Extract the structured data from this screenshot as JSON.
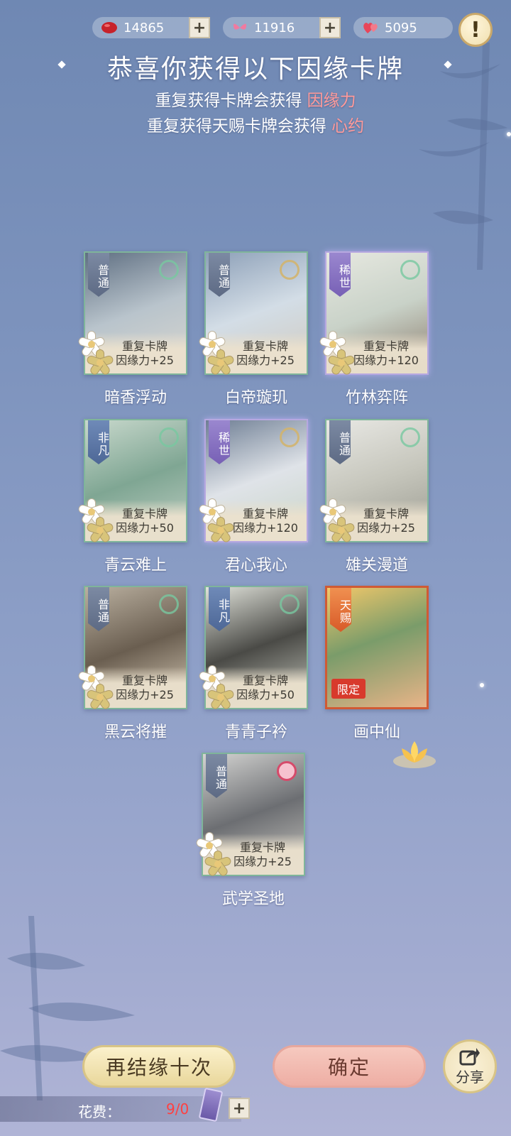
{
  "currency": [
    {
      "icon": "red-bean-icon",
      "value": "14865"
    },
    {
      "icon": "pink-butterfly-icon",
      "value": "11916"
    },
    {
      "icon": "heart-pair-icon",
      "value": "5095"
    }
  ],
  "info_label": "!",
  "headline": "恭喜你获得以下因缘卡牌",
  "sub1": {
    "text": "重复获得卡牌会获得",
    "highlight": "因缘力"
  },
  "sub2": {
    "text": "重复获得天赐卡牌会获得",
    "highlight": "心约"
  },
  "cards": [
    {
      "name": "暗香浮动",
      "tag": "普通",
      "line1": "重复卡牌",
      "line2": "因缘力+25"
    },
    {
      "name": "白帝璇玑",
      "tag": "普通",
      "line1": "重复卡牌",
      "line2": "因缘力+25"
    },
    {
      "name": "竹林弈阵",
      "tag": "稀世",
      "line1": "重复卡牌",
      "line2": "因缘力+120"
    },
    {
      "name": "青云难上",
      "tag": "非凡",
      "line1": "重复卡牌",
      "line2": "因缘力+50"
    },
    {
      "name": "君心我心",
      "tag": "稀世",
      "line1": "重复卡牌",
      "line2": "因缘力+120"
    },
    {
      "name": "雄关漫道",
      "tag": "普通",
      "line1": "重复卡牌",
      "line2": "因缘力+25"
    },
    {
      "name": "黑云将摧",
      "tag": "普通",
      "line1": "重复卡牌",
      "line2": "因缘力+25"
    },
    {
      "name": "青青子衿",
      "tag": "非凡",
      "line1": "重复卡牌",
      "line2": "因缘力+50"
    },
    {
      "name": "画中仙",
      "tag": "天赐",
      "limited": "限定"
    },
    {
      "name": "武学圣地",
      "tag": "普通",
      "line1": "重复卡牌",
      "line2": "因缘力+25"
    }
  ],
  "buttons": {
    "again": "再结缘十次",
    "confirm": "确定",
    "share": "分享"
  },
  "cost": {
    "label": "花费：",
    "value": "9/0",
    "plus": "+"
  },
  "plus": "+"
}
